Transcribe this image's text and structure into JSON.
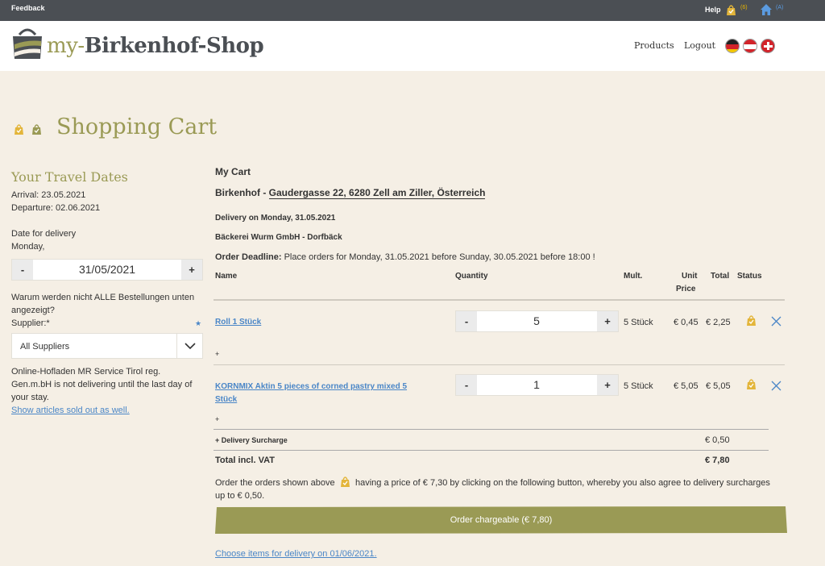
{
  "topbar": {
    "feedback": "Feedback",
    "help": "Help",
    "cart_count": "(6)",
    "home_count": "(A)"
  },
  "header": {
    "logo_my": "my-",
    "logo_name": "Birkenhof-Shop",
    "nav": {
      "products": "Products",
      "logout": "Logout"
    },
    "flags": [
      "de-flag-icon",
      "at-flag-icon",
      "ch-flag-icon"
    ]
  },
  "page_title": "Shopping Cart",
  "sidebar": {
    "heading": "Your Travel Dates",
    "arrival": "Arrival: 23.05.2021",
    "departure": "Departure: 02.06.2021",
    "delivery_label": "Date for delivery",
    "delivery_day": "Monday,",
    "date_minus": "-",
    "date_value": "31/05/2021",
    "date_plus": "+",
    "why_line1": "Warum werden nicht ALLE Bestellungen unten",
    "why_line2": "angezeigt?",
    "supplier_label": "Supplier:*",
    "supplier_star": "★",
    "supplier_value": "All Suppliers",
    "notice_line1": "Online-Hofladen MR Service Tirol reg.",
    "notice_line2": "Gen.m.bH is not delivering until the last day of",
    "notice_line3": "your stay.",
    "sold_out_link": "Show articles sold out as well."
  },
  "cart": {
    "heading": "My Cart",
    "location_name": "Birkenhof - ",
    "location_address": "Gaudergasse 22, 6280 Zell am Ziller, Österreich",
    "delivery_on": "Delivery on Monday, 31.05.2021",
    "supplier": "Bäckerei Wurm GmbH - Dorfbäck",
    "deadline_label": "Order Deadline:",
    "deadline_text": " Place orders for Monday, 31.05.2021 before Sunday, 30.05.2021 before 18:00 !",
    "columns": {
      "name": "Name",
      "quantity": "Quantity",
      "mult": "Mult.",
      "unit1": "Unit",
      "unit2": "Price",
      "total": "Total",
      "status": "Status"
    },
    "items": [
      {
        "name": "Roll 1 Stück",
        "name2": "",
        "minus": "-",
        "qty": "5",
        "plus": "+",
        "mult": "5 Stück",
        "unit_price": "€ 0,45",
        "total": "€ 2,25",
        "add": "+"
      },
      {
        "name": "KORNMIX Aktin 5 pieces of corned pastry mixed 5",
        "name2": "Stück",
        "minus": "-",
        "qty": "1",
        "plus": "+",
        "mult": "5 Stück",
        "unit_price": "€ 5,05",
        "total": "€ 5,05",
        "add": "+"
      }
    ],
    "surcharge_label": "+ Delivery Surcharge",
    "surcharge_value": "€ 0,50",
    "total_label": "Total incl. VAT",
    "total_value": "€ 7,80",
    "info_part1": "Order the orders shown above",
    "info_part2": "having a price of € 7,30 by clicking on the following button, whereby you also agree to delivery surcharges",
    "info_line2": "up to € 0,50.",
    "order_button": "Order chargeable (€ 7,80)",
    "next_link": "Choose items for delivery on 01/06/2021."
  },
  "colors": {
    "accent": "#9a9a55",
    "bag": "#e3b53a",
    "link": "#4a86c7",
    "background": "#f5efe5"
  }
}
